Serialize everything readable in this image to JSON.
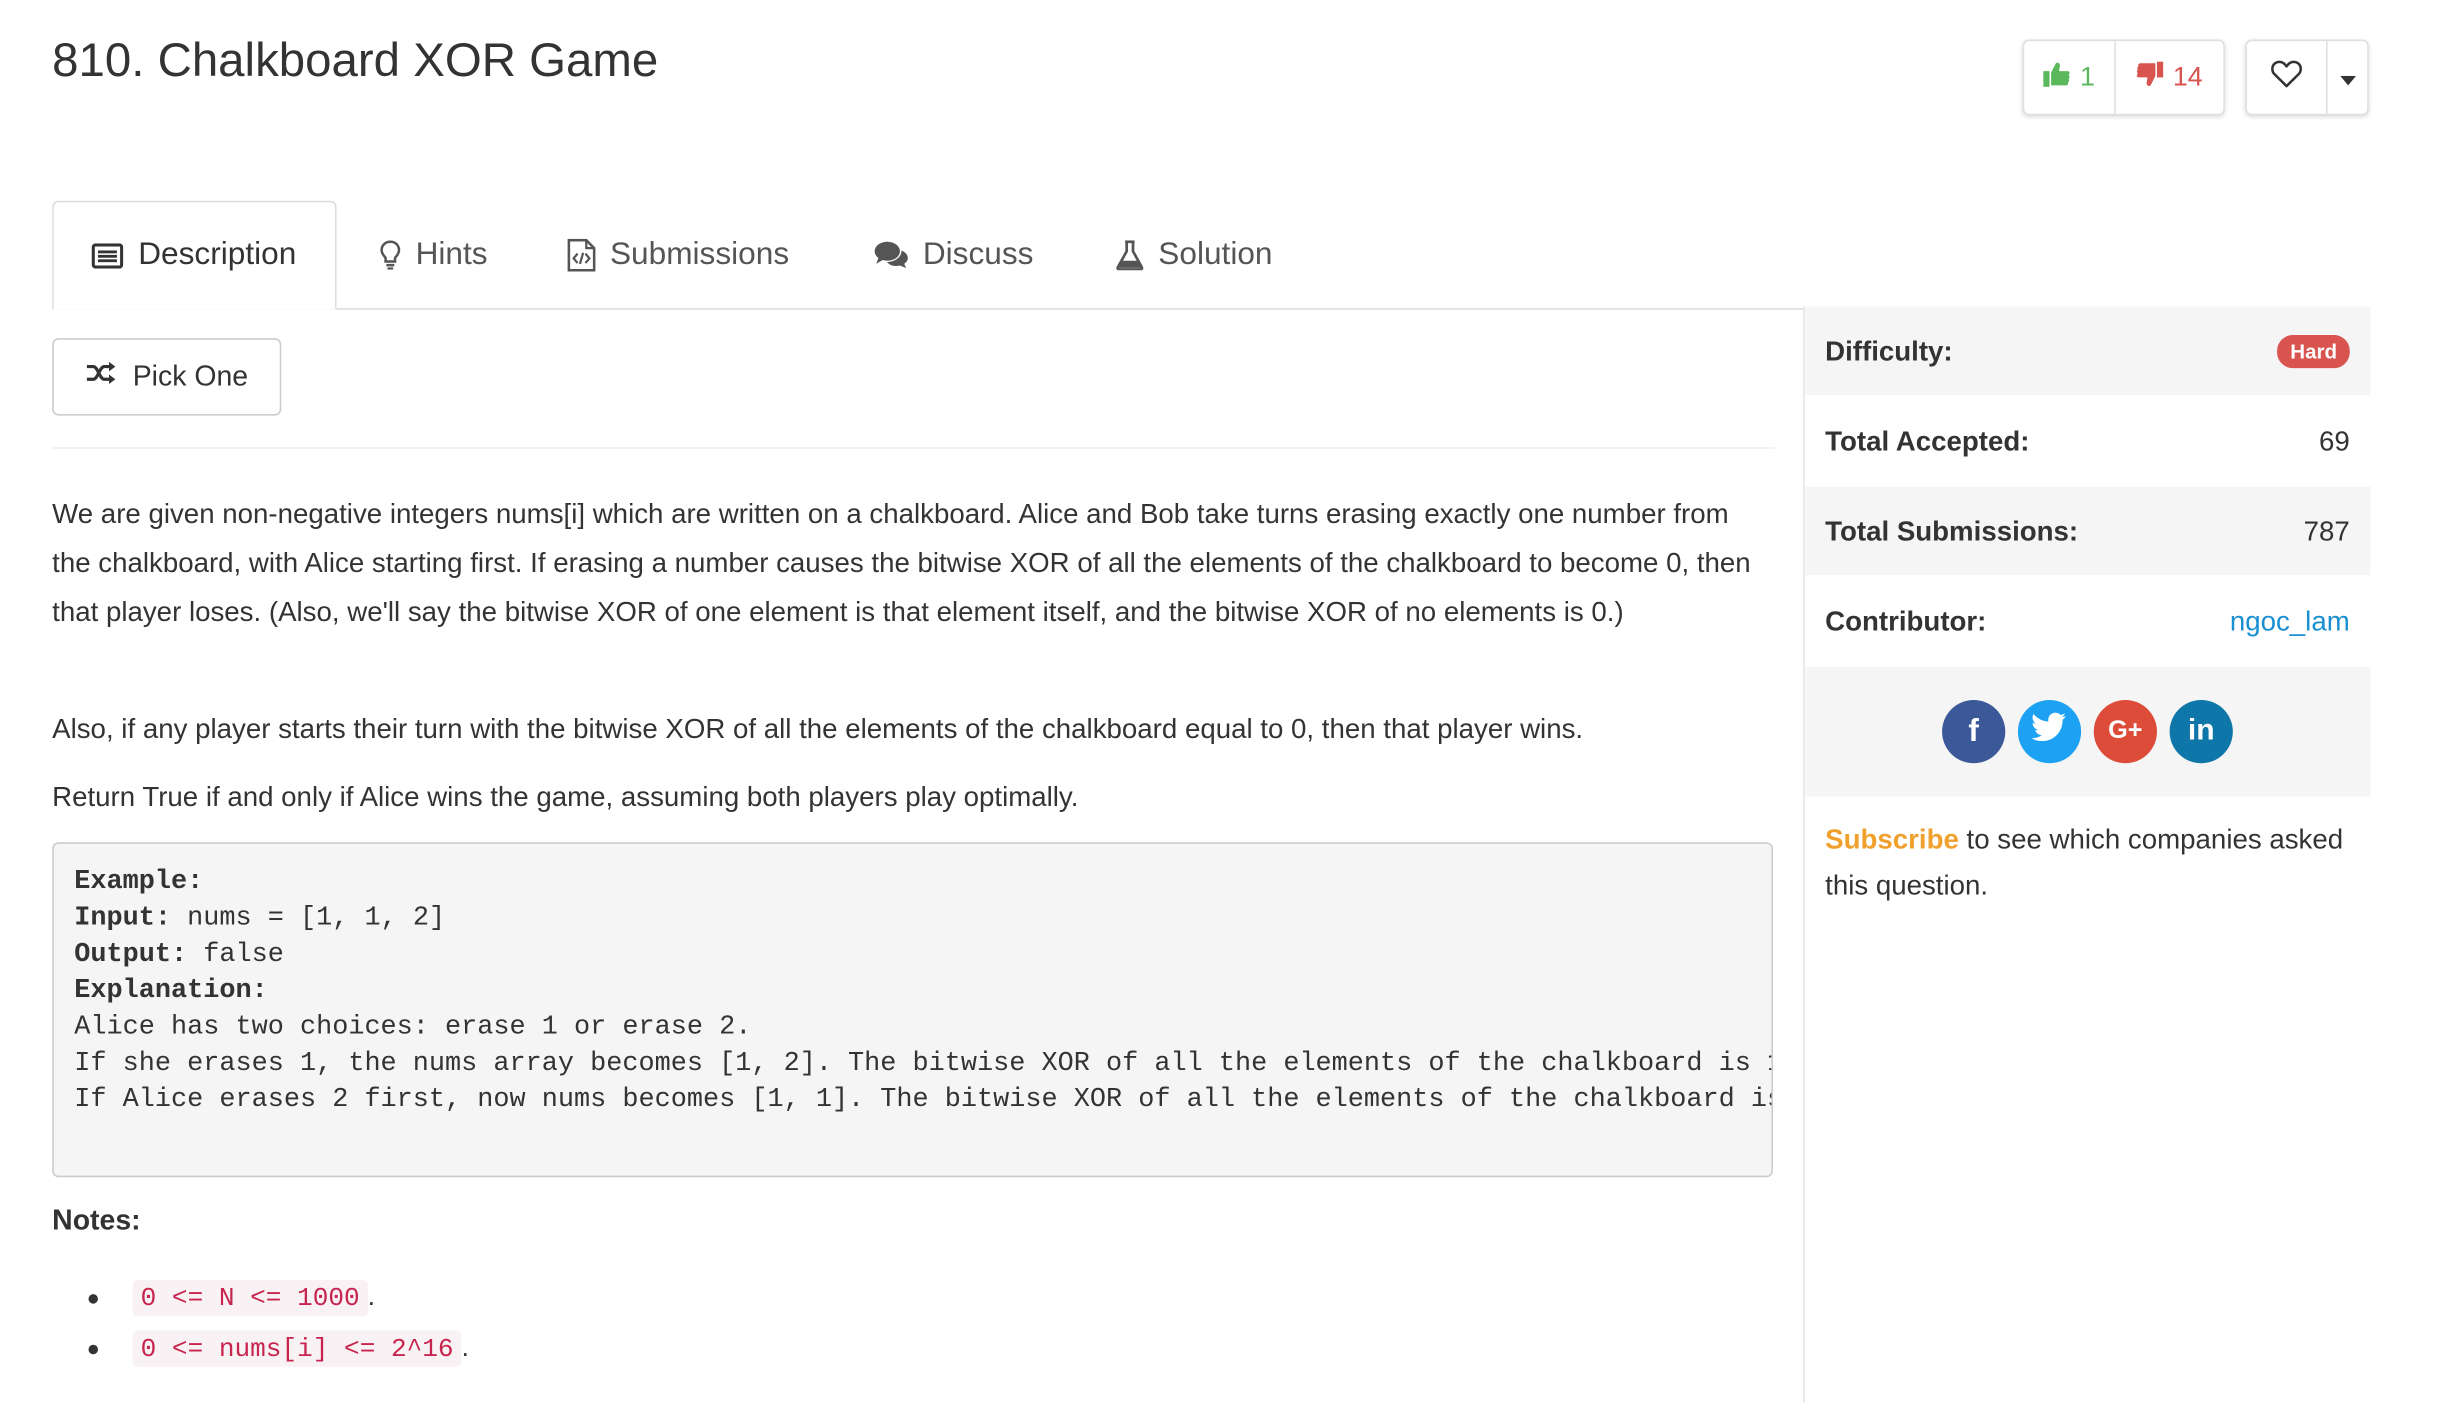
{
  "problem": {
    "title": "810. Chalkboard XOR Game"
  },
  "votes": {
    "likes": "1",
    "dislikes": "14"
  },
  "tabs": [
    {
      "label": "Description",
      "icon": "list-icon"
    },
    {
      "label": "Hints",
      "icon": "lightbulb-icon"
    },
    {
      "label": "Submissions",
      "icon": "code-file-icon"
    },
    {
      "label": "Discuss",
      "icon": "comments-icon"
    },
    {
      "label": "Solution",
      "icon": "flask-icon"
    }
  ],
  "pick_one_label": "Pick One",
  "description": {
    "p1": "We are given non-negative integers nums[i] which are written on a chalkboard.  Alice and Bob take turns erasing exactly one number from the chalkboard, with Alice starting first.  If erasing a number causes the bitwise XOR of all the elements of the chalkboard to become 0, then that player loses.  (Also, we'll say the bitwise XOR of one element is that element itself, and the bitwise XOR of no elements is 0.)",
    "p2": "Also, if any player starts their turn with the bitwise XOR of all the elements of the chalkboard equal to 0, then that player wins.",
    "p3": "Return True if and only if Alice wins the game, assuming both players play optimally."
  },
  "example": {
    "heading": "Example:",
    "input_label": "Input:",
    "input_value": " nums = [1, 1, 2]",
    "output_label": "Output:",
    "output_value": " false",
    "explanation_label": "Explanation:",
    "line1": "Alice has two choices: erase 1 or erase 2.",
    "line2": "If she erases 1, the nums array becomes [1, 2]. The bitwise XOR of all the elements of the chalkboard is 1",
    "line3": "If Alice erases 2 first, now nums becomes [1, 1]. The bitwise XOR of all the elements of the chalkboard is"
  },
  "notes": {
    "heading": "Notes:",
    "items": [
      "0 <= N <= 1000",
      "0 <= nums[i] <= 2^16"
    ],
    "suffix": "."
  },
  "sidebar": {
    "difficulty_label": "Difficulty:",
    "difficulty_value": "Hard",
    "accepted_label": "Total Accepted:",
    "accepted_value": "69",
    "submissions_label": "Total Submissions:",
    "submissions_value": "787",
    "contributor_label": "Contributor:",
    "contributor_value": "ngoc_lam",
    "social": {
      "facebook": "f",
      "google": "G+",
      "linkedin": "in"
    },
    "subscribe_link": "Subscribe",
    "subscribe_text": " to see which companies asked this question."
  },
  "colors": {
    "like": "#5cb85c",
    "dislike": "#d9534f",
    "hard_badge": "#d9534f",
    "link": "#1a8fd1",
    "subscribe": "#f0a02c",
    "facebook": "#3b5998",
    "twitter": "#1da1f2",
    "google": "#dd4b39",
    "linkedin": "#0e76a8"
  }
}
